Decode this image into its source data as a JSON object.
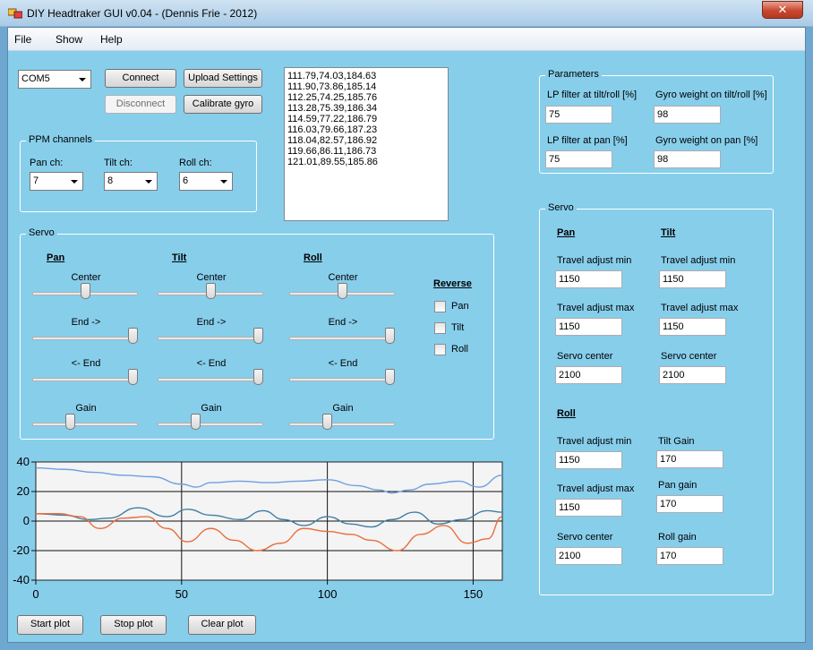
{
  "window": {
    "title": "DIY Headtraker GUI v0.04  -  (Dennis Frie - 2012)",
    "close_glyph": "✕"
  },
  "menu": [
    "File",
    "Show",
    "Help"
  ],
  "connection": {
    "port": "COM5",
    "connect_label": "Connect",
    "disconnect_label": "Disconnect",
    "upload_label": "Upload Settings",
    "calibrate_label": "Calibrate gyro"
  },
  "log_lines": [
    "111.79,74.03,184.63",
    "111.90,73.86,185.14",
    "112.25,74.25,185.76",
    "113.28,75.39,186.34",
    "114.59,77.22,186.79",
    "116.03,79.66,187.23",
    "118.04,82.57,186.92",
    "119.66,86.11,186.73",
    "121.01,89.55,185.86"
  ],
  "ppm": {
    "title": "PPM channels",
    "pan_label": "Pan ch:",
    "pan_value": "7",
    "tilt_label": "Tilt ch:",
    "tilt_value": "8",
    "roll_label": "Roll ch:",
    "roll_value": "6"
  },
  "servo_left": {
    "title": "Servo",
    "axes": [
      "Pan",
      "Tilt",
      "Roll"
    ],
    "slider_labels": [
      "Center",
      "End ->",
      "<- End",
      "Gain"
    ],
    "sliders": {
      "pan": [
        0.5,
        1.0,
        1.0,
        0.35
      ],
      "tilt": [
        0.5,
        1.0,
        1.0,
        0.35
      ],
      "roll": [
        0.5,
        1.0,
        1.0,
        0.35
      ]
    },
    "reverse_title": "Reverse",
    "reverse_items": [
      "Pan",
      "Tilt",
      "Roll"
    ]
  },
  "parameters": {
    "title": "Parameters",
    "lp_tiltroll_label": "LP filter at tilt/roll [%]",
    "lp_tiltroll_value": "75",
    "gyro_tiltroll_label": "Gyro weight on tilt/roll [%]",
    "gyro_tiltroll_value": "98",
    "lp_pan_label": "LP filter at pan [%]",
    "lp_pan_value": "75",
    "gyro_pan_label": "Gyro weight on pan [%]",
    "gyro_pan_value": "98"
  },
  "servo_right": {
    "title": "Servo",
    "pan_header": "Pan",
    "tilt_header": "Tilt",
    "roll_header": "Roll",
    "pan_travel_min_label": "Travel adjust min",
    "pan_travel_min": "1150",
    "tilt_travel_min_label": "Travel adjust min",
    "tilt_travel_min": "1150",
    "pan_travel_max_label": "Travel adjust max",
    "pan_travel_max": "1150",
    "tilt_travel_max_label": "Travel adjust max",
    "tilt_travel_max": "1150",
    "pan_center_label": "Servo center",
    "pan_center": "2100",
    "tilt_center_label": "Servo center",
    "tilt_center": "2100",
    "roll_travel_min_label": "Travel adjust min",
    "roll_travel_min": "1150",
    "tilt_gain_label": "Tilt Gain",
    "tilt_gain": "170",
    "roll_travel_max_label": "Travel adjust max",
    "roll_travel_max": "1150",
    "pan_gain_label": "Pan gain",
    "pan_gain": "170",
    "roll_center_label": "Servo center",
    "roll_center": "2100",
    "roll_gain_label": "Roll gain",
    "roll_gain": "170"
  },
  "plot_buttons": {
    "start": "Start plot",
    "stop": "Stop plot",
    "clear": "Clear plot"
  },
  "chart_data": {
    "type": "line",
    "xlim": [
      0,
      160
    ],
    "ylim": [
      -40,
      40
    ],
    "xticks": [
      0,
      50,
      100,
      150
    ],
    "yticks": [
      40,
      20,
      0,
      -20,
      -40
    ],
    "grid": true,
    "series": [
      {
        "color": "#6f9fe0",
        "points": [
          [
            0,
            36
          ],
          [
            10,
            35
          ],
          [
            20,
            33
          ],
          [
            30,
            31
          ],
          [
            40,
            30
          ],
          [
            50,
            25
          ],
          [
            55,
            23
          ],
          [
            60,
            26
          ],
          [
            70,
            27
          ],
          [
            80,
            26
          ],
          [
            90,
            27
          ],
          [
            100,
            28
          ],
          [
            110,
            24
          ],
          [
            118,
            21
          ],
          [
            122,
            19
          ],
          [
            128,
            21
          ],
          [
            135,
            25
          ],
          [
            145,
            27
          ],
          [
            152,
            23
          ],
          [
            160,
            31
          ]
        ]
      },
      {
        "color": "#3f7fa5",
        "points": [
          [
            0,
            5
          ],
          [
            10,
            4
          ],
          [
            18,
            1
          ],
          [
            25,
            2
          ],
          [
            35,
            9
          ],
          [
            45,
            3
          ],
          [
            52,
            8
          ],
          [
            60,
            4
          ],
          [
            70,
            1
          ],
          [
            78,
            7
          ],
          [
            85,
            1
          ],
          [
            92,
            -3
          ],
          [
            100,
            3
          ],
          [
            108,
            -2
          ],
          [
            115,
            -4
          ],
          [
            122,
            1
          ],
          [
            130,
            6
          ],
          [
            138,
            -2
          ],
          [
            146,
            1
          ],
          [
            155,
            7
          ],
          [
            160,
            6
          ]
        ]
      },
      {
        "color": "#e86f3c",
        "points": [
          [
            0,
            5
          ],
          [
            8,
            5
          ],
          [
            15,
            3
          ],
          [
            22,
            -5
          ],
          [
            30,
            2
          ],
          [
            38,
            3
          ],
          [
            45,
            -5
          ],
          [
            52,
            -14
          ],
          [
            60,
            -5
          ],
          [
            68,
            -13
          ],
          [
            76,
            -20
          ],
          [
            84,
            -15
          ],
          [
            92,
            -5
          ],
          [
            100,
            -7
          ],
          [
            108,
            -9
          ],
          [
            115,
            -13
          ],
          [
            124,
            -20
          ],
          [
            132,
            -9
          ],
          [
            140,
            -3
          ],
          [
            148,
            -15
          ],
          [
            155,
            -12
          ],
          [
            160,
            3
          ]
        ]
      }
    ]
  }
}
